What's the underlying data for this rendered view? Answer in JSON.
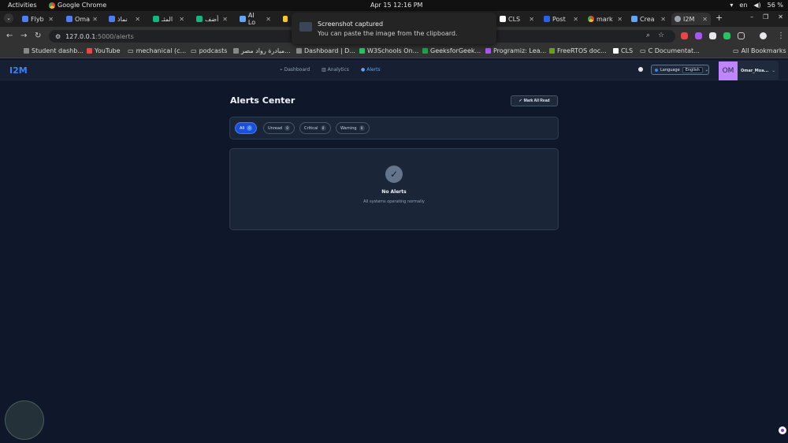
{
  "system": {
    "activities": "Activities",
    "app_name": "Google Chrome",
    "clock": "Apr 15  12:16 PM",
    "lang": "en",
    "battery": "56 %"
  },
  "tabs": [
    {
      "label": "Flyb"
    },
    {
      "label": "Oma"
    },
    {
      "label": "نماذ"
    },
    {
      "label": "المثـ"
    },
    {
      "label": "أضف"
    },
    {
      "label": "AI Lo"
    },
    {
      "label": "CLS"
    },
    {
      "label": "Post"
    },
    {
      "label": "mark"
    },
    {
      "label": "Crea"
    },
    {
      "label": "I2M"
    }
  ],
  "toast": {
    "title": "Screenshot captured",
    "message": "You can paste the image from the clipboard."
  },
  "omnibox": {
    "host": "127.0.0.1",
    "path": ":5000/alerts"
  },
  "bookmarks": [
    {
      "label": "Student dashb..."
    },
    {
      "label": "YouTube"
    },
    {
      "label": "mechanical (c..."
    },
    {
      "label": "podcasts"
    },
    {
      "label": "مبادرة رواد مصر..."
    },
    {
      "label": "Dashboard | D..."
    },
    {
      "label": "W3Schools On..."
    },
    {
      "label": "GeeksforGeek..."
    },
    {
      "label": "Programiz: Lea..."
    },
    {
      "label": "FreeRTOS doc..."
    },
    {
      "label": "CLS"
    },
    {
      "label": "C Documentat..."
    },
    {
      "label": "All Bookmarks"
    }
  ],
  "app": {
    "brand": "I2M",
    "nav": {
      "dashboard": "Dashboard",
      "analytics": "Analytics",
      "alerts": "Alerts"
    },
    "language_label": "Language",
    "language_value": "English",
    "user_initials": "OM",
    "user_name": "Omar_Moa..."
  },
  "alerts": {
    "title": "Alerts Center",
    "mark_all_read": "Mark All Read",
    "filters": [
      {
        "label": "All",
        "count": "0"
      },
      {
        "label": "Unread",
        "count": "0"
      },
      {
        "label": "Critical",
        "count": "0"
      },
      {
        "label": "Warning",
        "count": "0"
      }
    ],
    "empty_title": "No Alerts",
    "empty_message": "All systems operating normally"
  }
}
